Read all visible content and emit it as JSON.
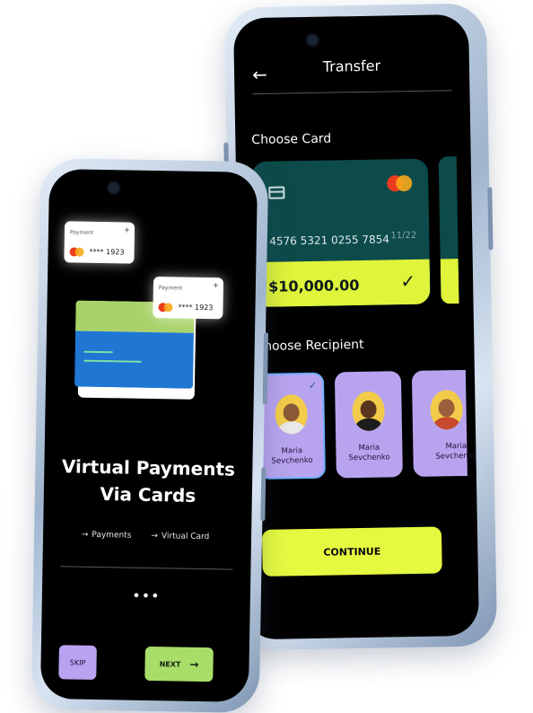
{
  "transfer_screen": {
    "title": "Transfer",
    "back_icon": "arrow-left-icon",
    "choose_card_label": "Choose Card",
    "card": {
      "number": "4576 5321 0255 7854",
      "expiry": "11/22",
      "balance": "$10,000.00",
      "selected_icon": "check-icon",
      "colors": {
        "top": "#0d4b4b",
        "bottom": "#dff43a"
      }
    },
    "choose_recipient_label": "Choose Recipient",
    "recipients": [
      {
        "name_line1": "Maria",
        "name_line2": "Sevchenko",
        "selected": true
      },
      {
        "name_line1": "Maria",
        "name_line2": "Sevchenko",
        "selected": false
      },
      {
        "name_line1": "Maria",
        "name_line2": "Sevchenko",
        "selected": false
      }
    ],
    "continue_label": "CONTINUE"
  },
  "onboarding_screen": {
    "mini_cards": [
      {
        "label": "Payment",
        "number": "**** 1923"
      },
      {
        "label": "Payment",
        "number": "**** 1923"
      }
    ],
    "headline_line1": "Virtual Payments",
    "headline_line2": "Via Cards",
    "features": [
      {
        "label": "Payments",
        "icon": "arrow-right-icon"
      },
      {
        "label": "Virtual Card",
        "icon": "arrow-right-icon"
      }
    ],
    "pager_dots": "•••",
    "skip_label": "SKIP",
    "next_label": "NEXT",
    "next_icon": "arrow-right-icon"
  },
  "colors": {
    "accent_yellow": "#e5f941",
    "accent_purple": "#b9a2f0",
    "accent_green": "#a9dd6a",
    "screen_bg": "#000000"
  }
}
